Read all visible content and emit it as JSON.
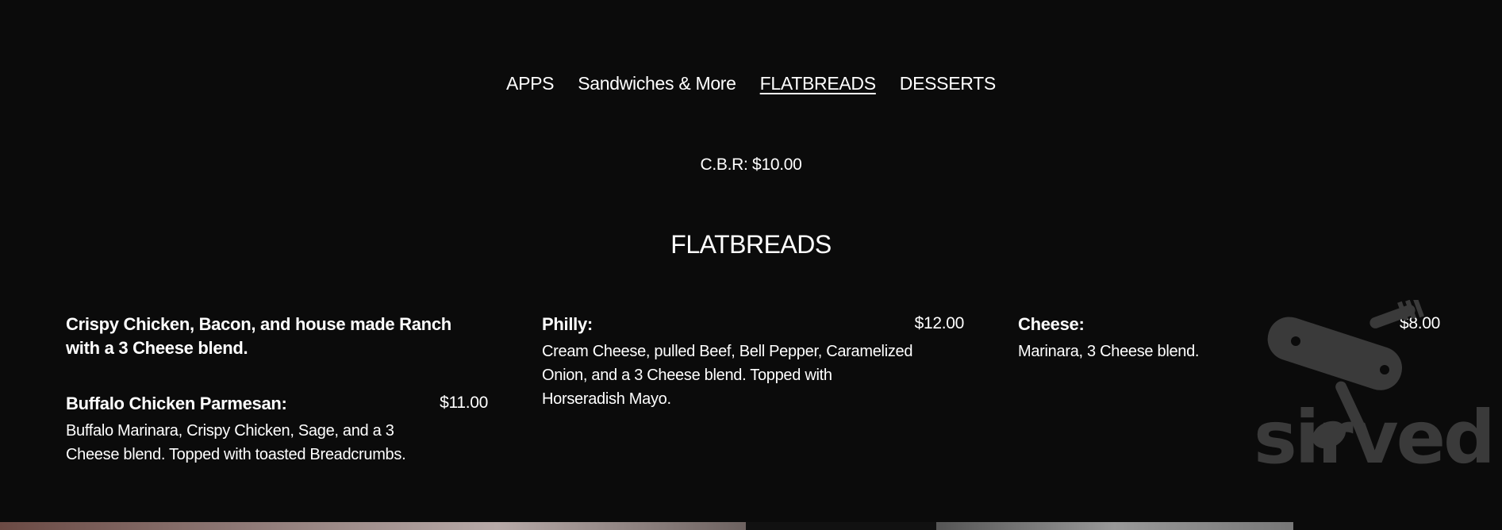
{
  "nav": {
    "items": [
      {
        "label": "APPS",
        "active": false
      },
      {
        "label": "Sandwiches & More",
        "active": false
      },
      {
        "label": "FLATBREADS",
        "active": true
      },
      {
        "label": "DESSERTS",
        "active": false
      }
    ]
  },
  "note": "C.B.R: $10.00",
  "section": {
    "title": "FLATBREADS"
  },
  "columns": [
    {
      "items": [
        {
          "name": "Crispy Chicken, Bacon, and house made Ranch with a 3 Cheese blend.",
          "price": "",
          "description": ""
        },
        {
          "name": "Buffalo Chicken Parmesan:",
          "price": "$11.00",
          "description": "Buffalo Marinara, Crispy Chicken, Sage, and a 3 Cheese blend. Topped with toasted Breadcrumbs."
        }
      ]
    },
    {
      "items": [
        {
          "name": "Philly:",
          "price": "$12.00",
          "description": "Cream Cheese, pulled Beef, Bell Pepper, Caramelized Onion, and a 3 Cheese blend. Topped with Horseradish Mayo."
        }
      ]
    },
    {
      "items": [
        {
          "name": "Cheese:",
          "price": "$8.00",
          "description": "Marinara, 3 Cheese blend."
        }
      ]
    }
  ],
  "watermark": {
    "brand": "sirved",
    "icon": "pocket-knife-fork-spoon-icon",
    "color": "#3a3a3a"
  },
  "colors": {
    "background": "#0b0b0b",
    "text": "#ffffff"
  }
}
